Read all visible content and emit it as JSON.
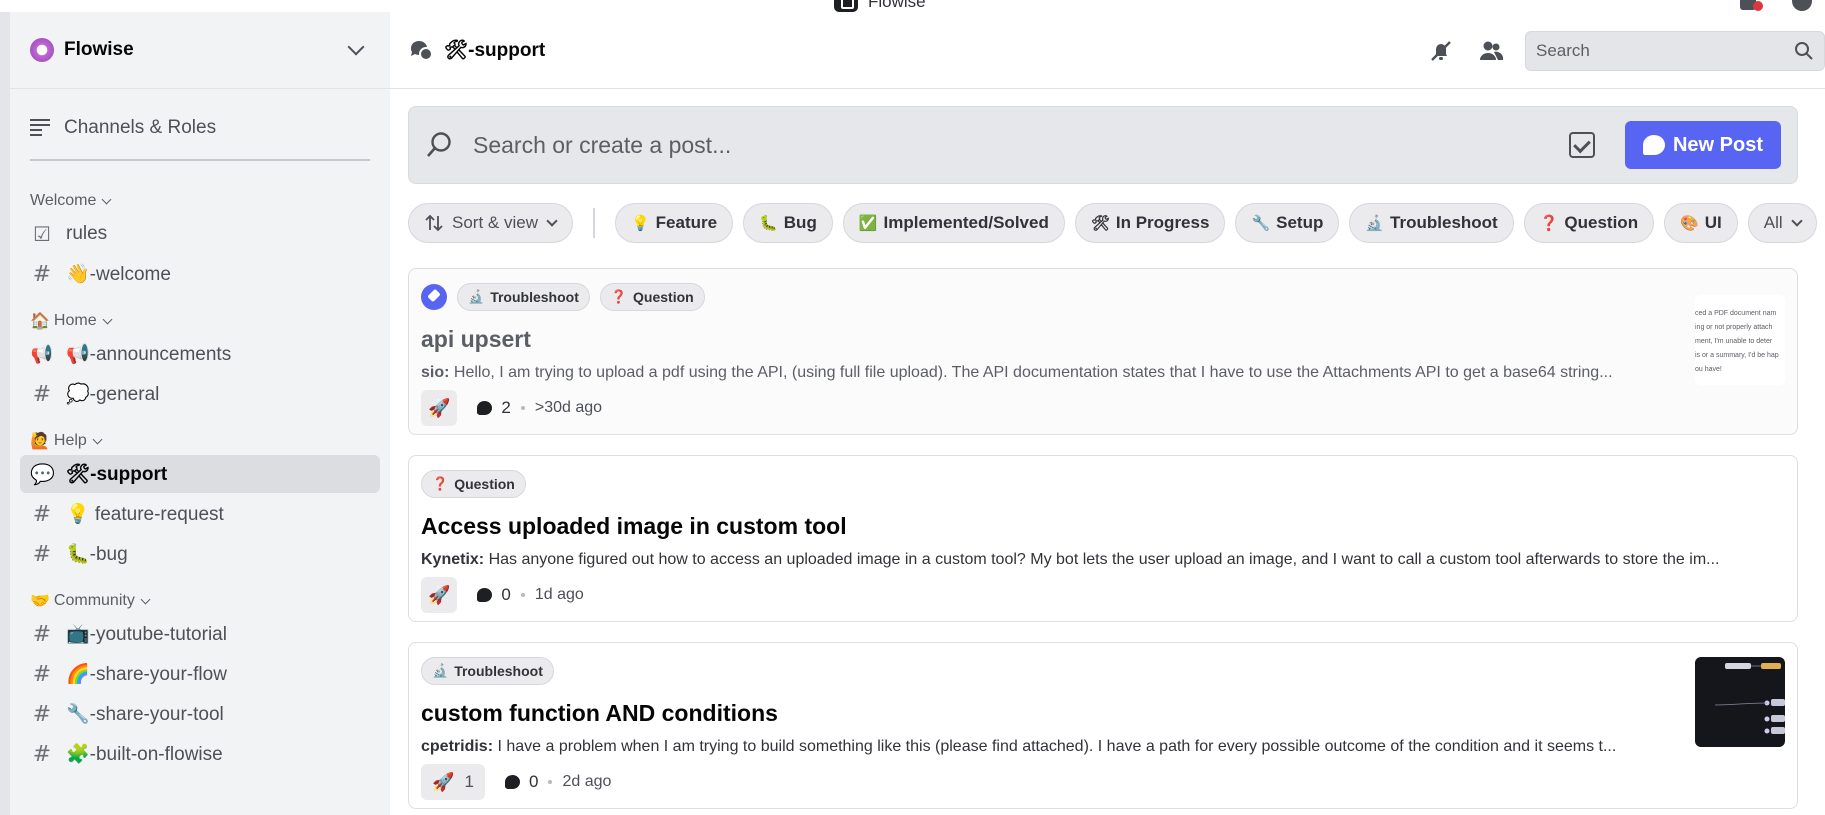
{
  "window": {
    "title": "Flowise"
  },
  "server": {
    "name": "Flowise"
  },
  "sidebar": {
    "browse_label": "Channels & Roles",
    "categories": [
      {
        "label": "Welcome",
        "emoji": ""
      },
      {
        "label": "Home",
        "emoji": "🏠"
      },
      {
        "label": "Help",
        "emoji": "🙋"
      },
      {
        "label": "Community",
        "emoji": "🤝"
      }
    ],
    "channels": [
      {
        "label": "rules",
        "icon": "rules-check-icon"
      },
      {
        "label": "👋-welcome",
        "icon": "hash-icon"
      },
      {
        "label": "📢-announcements",
        "icon": "megaphone-icon"
      },
      {
        "label": "💭-general",
        "icon": "hash-icon"
      },
      {
        "label": "🛠-support",
        "icon": "forum-icon"
      },
      {
        "label": "💡 feature-request",
        "icon": "hash-icon"
      },
      {
        "label": "🐛-bug",
        "icon": "hash-icon"
      },
      {
        "label": "📺-youtube-tutorial",
        "icon": "hash-icon"
      },
      {
        "label": "🌈-share-your-flow",
        "icon": "hash-icon"
      },
      {
        "label": "🔧-share-your-tool",
        "icon": "hash-icon"
      },
      {
        "label": "🧩-built-on-flowise",
        "icon": "hash-icon"
      }
    ]
  },
  "header": {
    "channel_title": "🛠-support",
    "search_placeholder": "Search"
  },
  "forum": {
    "search_placeholder": "Search or create a post...",
    "new_post_label": "New Post",
    "sort_label": "Sort & view",
    "all_label": "All",
    "filter_tags": [
      {
        "emoji": "💡",
        "label": "Feature"
      },
      {
        "emoji": "🐛",
        "label": "Bug"
      },
      {
        "emoji": "✅",
        "label": "Implemented/Solved"
      },
      {
        "emoji": "🛠",
        "label": "In Progress"
      },
      {
        "emoji": "🔧",
        "label": "Setup"
      },
      {
        "emoji": "🔬",
        "label": "Troubleshoot"
      },
      {
        "emoji": "❓",
        "label": "Question"
      },
      {
        "emoji": "🎨",
        "label": "UI"
      }
    ]
  },
  "posts": [
    {
      "pinned": true,
      "tags": [
        {
          "emoji": "🔬",
          "label": "Troubleshoot"
        },
        {
          "emoji": "❓",
          "label": "Question"
        }
      ],
      "title": "api upsert",
      "author": "sio:",
      "snippet": "Hello, I am trying to upload a pdf using the API, (using full file upload). The API documentation states that I have to use the Attachments API to get a base64 string...",
      "reaction_emoji": "🚀",
      "reaction_count": "",
      "message_count": "2",
      "time": ">30d ago",
      "thumbnail_lines": [
        "ced a PDF document nam",
        "ing or not properly attach",
        "ment, I'm unable to deter",
        "is or a summary, I'd be hap",
        "ou have!"
      ]
    },
    {
      "pinned": false,
      "tags": [
        {
          "emoji": "❓",
          "label": "Question"
        }
      ],
      "title": "Access uploaded image in custom tool",
      "author": "Kynetix:",
      "snippet": "Has anyone figured out how to access an uploaded image in a custom tool? My bot lets the user upload an image, and I want to call a custom tool afterwards to store the im...",
      "reaction_emoji": "🚀",
      "reaction_count": "",
      "message_count": "0",
      "time": "1d ago"
    },
    {
      "pinned": false,
      "tags": [
        {
          "emoji": "🔬",
          "label": "Troubleshoot"
        }
      ],
      "title": "custom function AND conditions",
      "author": "cpetridis:",
      "snippet": "I have a problem when I am trying to build something like this (please find attached). I have a path for every possible outcome of the condition and it seems t...",
      "reaction_emoji": "🚀",
      "reaction_count": "1",
      "message_count": "0",
      "time": "2d ago"
    }
  ],
  "colors": {
    "accent": "#5865f2",
    "sidebar_bg": "#f2f3f5",
    "active_channel_bg": "#dbdde1"
  }
}
